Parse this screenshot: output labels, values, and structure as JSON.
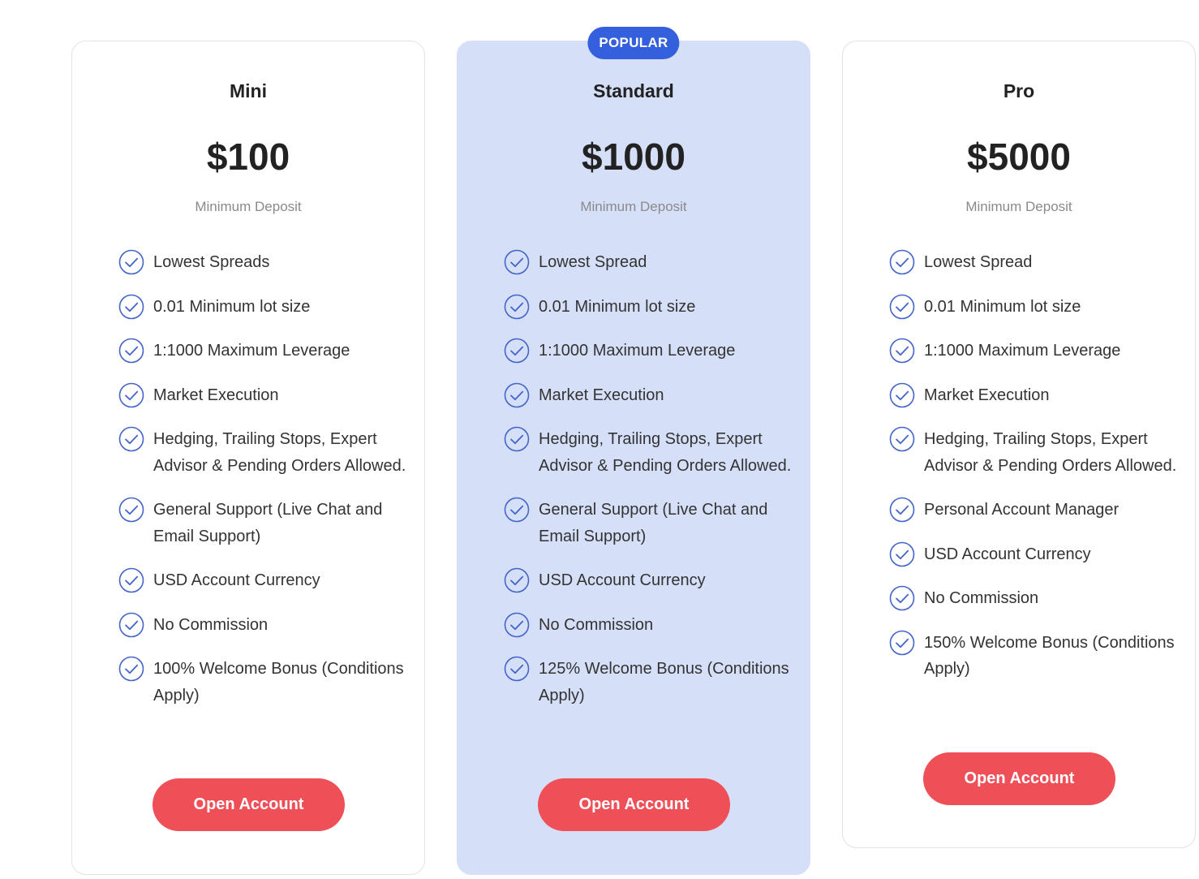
{
  "colors": {
    "accent": "#3560dd",
    "highlight_bg": "#d5e0f8",
    "button": "#ef5058",
    "check_icon": "#4565c9"
  },
  "plans": [
    {
      "name": "Mini",
      "price": "$100",
      "price_sub": "Minimum Deposit",
      "features": [
        "Lowest Spreads",
        "0.01 Minimum lot size",
        "1:1000 Maximum Leverage",
        "Market Execution",
        "Hedging, Trailing Stops, Expert Advisor & Pending Orders Allowed.",
        "General Support (Live Chat and Email Support)",
        "USD Account Currency",
        "No Commission",
        "100% Welcome Bonus (Conditions Apply)"
      ],
      "button_label": "Open Account"
    },
    {
      "name": "Standard",
      "badge": "POPULAR",
      "price": "$1000",
      "price_sub": "Minimum Deposit",
      "features": [
        "Lowest Spread",
        "0.01 Minimum lot size",
        "1:1000 Maximum Leverage",
        "Market Execution",
        "Hedging, Trailing Stops, Expert Advisor & Pending Orders Allowed.",
        "General Support (Live Chat and Email Support)",
        "USD Account Currency",
        "No Commission",
        "125% Welcome Bonus (Conditions Apply)"
      ],
      "button_label": "Open Account"
    },
    {
      "name": "Pro",
      "price": "$5000",
      "price_sub": "Minimum Deposit",
      "features": [
        "Lowest Spread",
        "0.01 Minimum lot size",
        "1:1000 Maximum Leverage",
        "Market Execution",
        "Hedging, Trailing Stops, Expert Advisor & Pending Orders Allowed.",
        "Personal Account Manager",
        "USD Account Currency",
        "No Commission",
        "150% Welcome Bonus (Conditions Apply)"
      ],
      "button_label": "Open Account"
    }
  ]
}
